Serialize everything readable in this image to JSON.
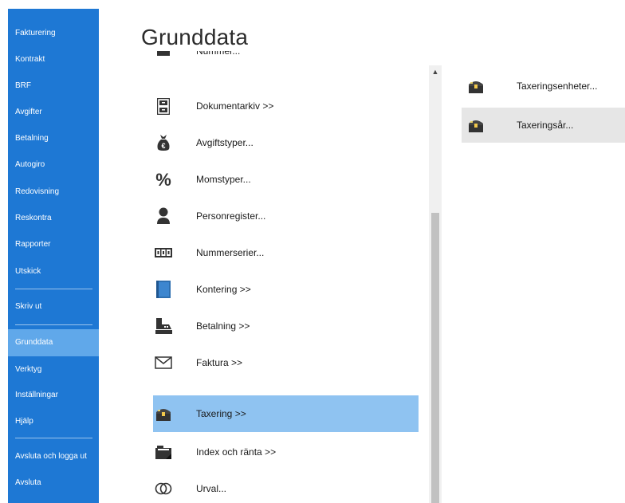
{
  "sidebar": {
    "items": [
      {
        "label": "Fakturering"
      },
      {
        "label": "Kontrakt"
      },
      {
        "label": "BRF"
      },
      {
        "label": "Avgifter"
      },
      {
        "label": "Betalning"
      },
      {
        "label": "Autogiro"
      },
      {
        "label": "Redovisning"
      },
      {
        "label": "Reskontra"
      },
      {
        "label": "Rapporter"
      },
      {
        "label": "Utskick"
      },
      {
        "label": "Skriv ut"
      },
      {
        "label": "Grunddata",
        "selected": true
      },
      {
        "label": "Verktyg"
      },
      {
        "label": "Inställningar"
      },
      {
        "label": "Hjälp"
      },
      {
        "label": "Avsluta och logga ut"
      },
      {
        "label": "Avsluta"
      }
    ]
  },
  "page": {
    "title": "Grunddata"
  },
  "middle_list": {
    "items": [
      {
        "label": "Nummer...",
        "icon": "generic-icon"
      },
      {
        "label": "Dokumentarkiv >>",
        "icon": "file-cabinet-icon"
      },
      {
        "label": "Avgiftstyper...",
        "icon": "money-bag-icon"
      },
      {
        "label": "Momstyper...",
        "icon": "percent-icon"
      },
      {
        "label": "Personregister...",
        "icon": "person-icon"
      },
      {
        "label": "Nummerserier...",
        "icon": "number-counter-icon"
      },
      {
        "label": "Kontering >>",
        "icon": "ledger-book-icon"
      },
      {
        "label": "Betalning >>",
        "icon": "cash-register-icon"
      },
      {
        "label": "Faktura >>",
        "icon": "envelope-icon"
      },
      {
        "label": "Taxering >>",
        "icon": "treasure-chest-icon",
        "selected": true
      },
      {
        "label": "Index och ränta >>",
        "icon": "folder-chart-icon"
      },
      {
        "label": "Urval...",
        "icon": "overlapping-circles-icon"
      }
    ]
  },
  "right_list": {
    "items": [
      {
        "label": "Taxeringsenheter...",
        "icon": "treasure-chest-icon"
      },
      {
        "label": "Taxeringsår...",
        "icon": "treasure-chest-icon",
        "selected": true
      }
    ]
  },
  "scrollbar": {
    "up_arrow": "▲"
  },
  "colors": {
    "sidebar_bg": "#1e78d4",
    "sidebar_selected": "#60a8ea",
    "list_selected": "#8fc3f1",
    "right_selected": "#e6e6e6"
  }
}
